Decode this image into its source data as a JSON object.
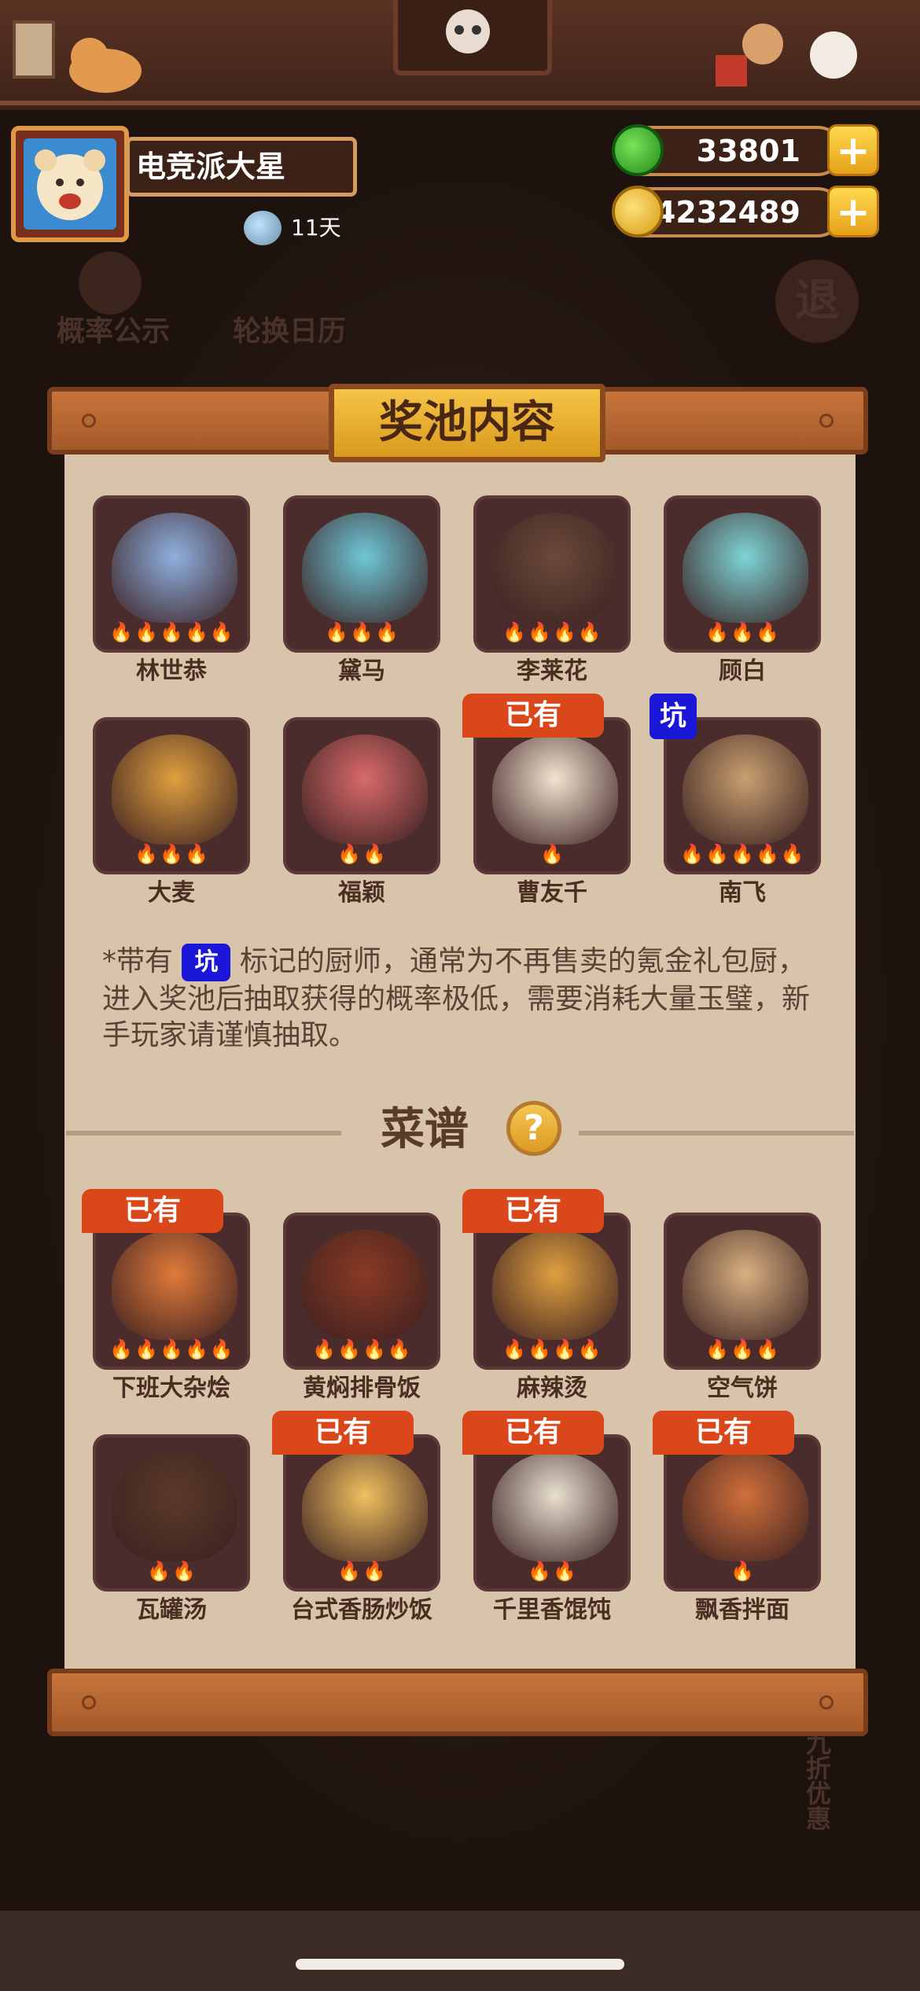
{
  "player": {
    "name": "电竞派大星",
    "days": "11天"
  },
  "currency": {
    "jade": "33801",
    "coins": "4232489",
    "plus": "+"
  },
  "background": {
    "probability": "概率公示",
    "calendar": "轮换日历",
    "retreat": "退",
    "discount": "九折优惠"
  },
  "modal": {
    "title": "奖池内容",
    "chefs": [
      {
        "name": "林世恭",
        "flames": 5,
        "owned": false,
        "pit": false,
        "color": "#8fb0e0"
      },
      {
        "name": "黛马",
        "flames": 3,
        "owned": false,
        "pit": false,
        "color": "#6fc7d8"
      },
      {
        "name": "李莱花",
        "flames": 4,
        "owned": false,
        "pit": false,
        "color": "#6b4a3a"
      },
      {
        "name": "顾白",
        "flames": 3,
        "owned": false,
        "pit": false,
        "color": "#7fd4d6"
      },
      {
        "name": "大麦",
        "flames": 3,
        "owned": false,
        "pit": false,
        "color": "#e0a040"
      },
      {
        "name": "福颖",
        "flames": 2,
        "owned": false,
        "pit": false,
        "color": "#d96a6a"
      },
      {
        "name": "曹友千",
        "flames": 1,
        "owned": true,
        "pit": false,
        "color": "#f3e3d0"
      },
      {
        "name": "南飞",
        "flames": 5,
        "owned": false,
        "pit": true,
        "color": "#c8a070"
      }
    ],
    "owned_label": "已有",
    "pit_label": "坑",
    "note_prefix": "*带有",
    "note_suffix": "标记的厨师，通常为不再售卖的氪金礼包厨，进入奖池后抽取获得的概率极低，需要消耗大量玉璧，新手玩家请谨慎抽取。",
    "recipes_title": "菜谱",
    "help": "?",
    "recipes": [
      {
        "name": "下班大杂烩",
        "flames": 5,
        "owned": true,
        "color": "#e07a3a"
      },
      {
        "name": "黄焖排骨饭",
        "flames": 4,
        "owned": false,
        "color": "#8a3a22"
      },
      {
        "name": "麻辣烫",
        "flames": 4,
        "owned": true,
        "color": "#e0a040"
      },
      {
        "name": "空气饼",
        "flames": 3,
        "owned": false,
        "color": "#d8b080"
      },
      {
        "name": "瓦罐汤",
        "flames": 2,
        "owned": false,
        "color": "#5a3a28"
      },
      {
        "name": "台式香肠炒饭",
        "flames": 2,
        "owned": true,
        "color": "#f0c060"
      },
      {
        "name": "千里香馄饨",
        "flames": 2,
        "owned": true,
        "color": "#e8e0d0"
      },
      {
        "name": "飘香拌面",
        "flames": 1,
        "owned": true,
        "color": "#d0703a"
      }
    ]
  }
}
